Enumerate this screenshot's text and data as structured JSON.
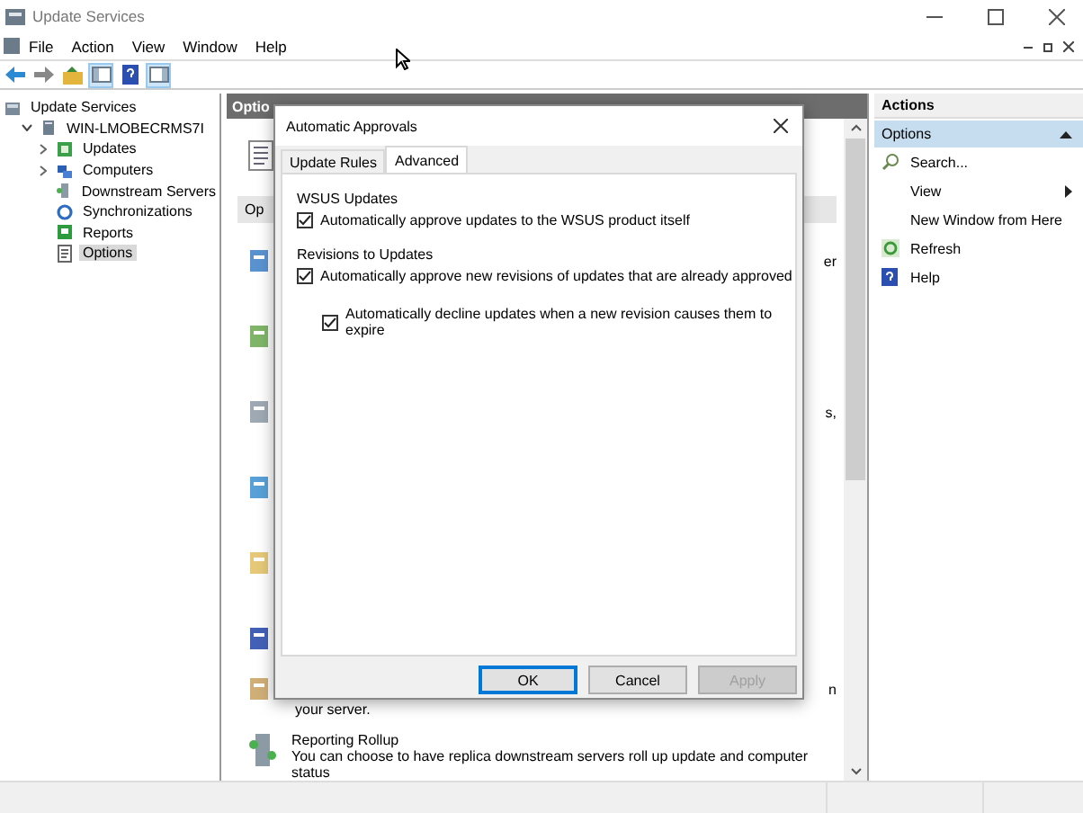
{
  "window": {
    "title": "Update Services"
  },
  "menu": [
    "File",
    "Action",
    "View",
    "Window",
    "Help"
  ],
  "toolbar": [
    {
      "kind": "back",
      "selected": false
    },
    {
      "kind": "forward",
      "selected": false
    },
    {
      "kind": "up",
      "selected": false
    },
    {
      "kind": "tree",
      "selected": true
    },
    {
      "kind": "help",
      "selected": false
    },
    {
      "kind": "pane",
      "selected": true
    }
  ],
  "tree": [
    {
      "label": "Update Services",
      "kind": "root",
      "selected": false,
      "children": [
        {
          "label": "WIN-LMOBECRMS7I",
          "kind": "server",
          "expanded": true,
          "selected": false,
          "children": [
            {
              "label": "Updates",
              "kind": "updates",
              "expanded": false,
              "selected": false
            },
            {
              "label": "Computers",
              "kind": "computers",
              "expanded": false,
              "selected": false
            },
            {
              "label": "Downstream Servers",
              "kind": "downstream",
              "selected": false
            },
            {
              "label": "Synchronizations",
              "kind": "sync",
              "selected": false
            },
            {
              "label": "Reports",
              "kind": "reports",
              "selected": false
            },
            {
              "label": "Options",
              "kind": "options",
              "selected": true
            }
          ]
        }
      ]
    }
  ],
  "center": {
    "header": "Optio",
    "section": "Op",
    "rows": [
      {
        "fragment": "er"
      },
      {
        "fragment": ""
      },
      {
        "fragment": "s,"
      },
      {
        "fragment": ""
      },
      {
        "fragment": ""
      },
      {
        "fragment": ""
      }
    ],
    "partial": {
      "fragment": "n",
      "continuation": "your server."
    },
    "item": {
      "title": "Reporting Rollup",
      "description": "You can choose to have replica downstream servers roll up update and computer status"
    }
  },
  "dialog": {
    "title": "Automatic Approvals",
    "tabs": [
      {
        "label": "Update Rules",
        "selected": false
      },
      {
        "label": "Advanced",
        "selected": true
      }
    ],
    "sections": [
      {
        "heading": "WSUS Updates",
        "options": [
          {
            "label": "Automatically approve updates to the WSUS product itself",
            "checked": true
          }
        ]
      },
      {
        "heading": "Revisions to Updates",
        "options": [
          {
            "label": "Automatically approve new revisions of updates that are already approved",
            "checked": true,
            "children": [
              {
                "label": "Automatically decline updates when a new revision causes them to expire",
                "checked": true
              }
            ]
          }
        ]
      }
    ],
    "buttons": [
      {
        "label": "OK",
        "default": true,
        "disabled": false
      },
      {
        "label": "Cancel",
        "default": false,
        "disabled": false
      },
      {
        "label": "Apply",
        "default": false,
        "disabled": true
      }
    ]
  },
  "actions": {
    "header": "Actions",
    "group": {
      "label": "Options",
      "expanded": true
    },
    "items": [
      {
        "label": "Search...",
        "kind": "search",
        "submenu": false
      },
      {
        "label": "View",
        "kind": "none",
        "submenu": true
      },
      {
        "label": "New Window from Here",
        "kind": "none",
        "submenu": false
      },
      {
        "label": "Refresh",
        "kind": "refresh",
        "submenu": false
      },
      {
        "label": "Help",
        "kind": "help",
        "submenu": false
      }
    ]
  }
}
